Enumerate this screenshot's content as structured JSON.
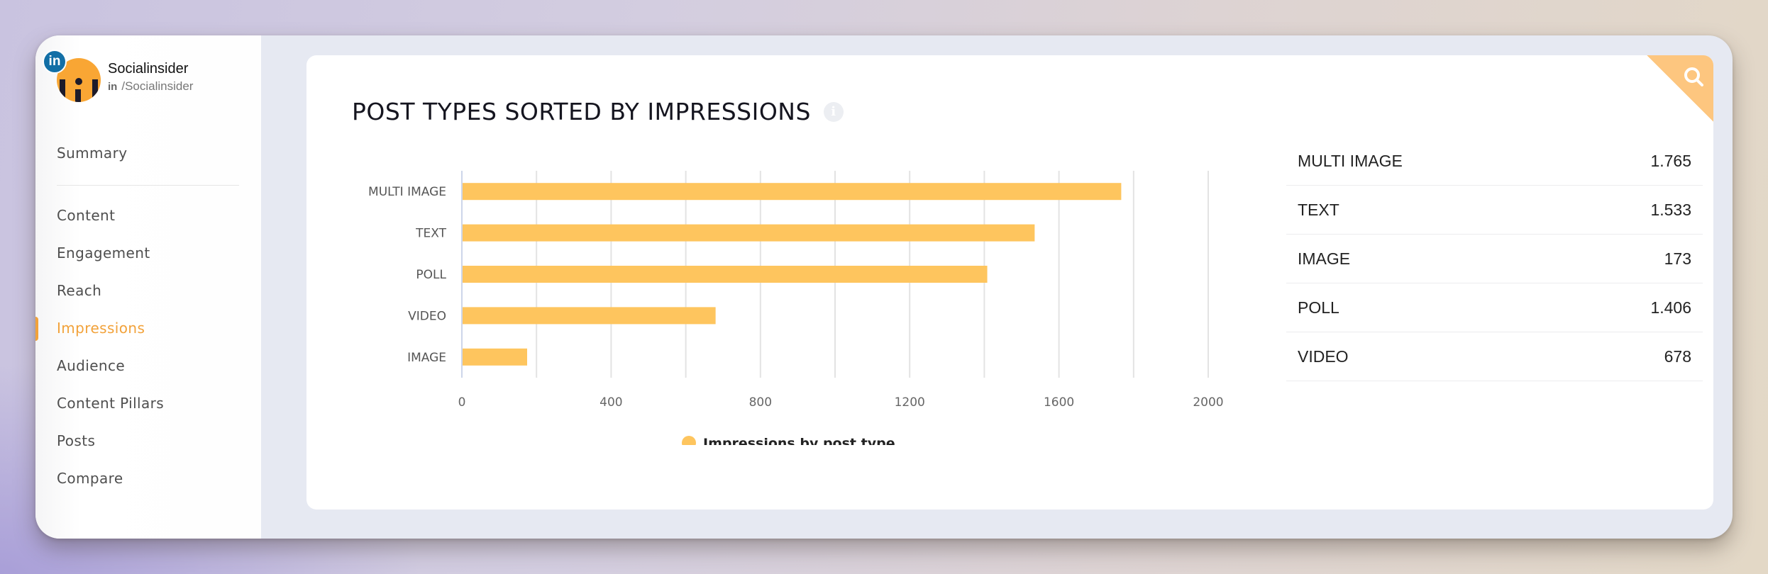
{
  "profile": {
    "name": "Socialinsider",
    "network_badge": "in",
    "handle_prefix": "in",
    "handle": "/Socialinsider"
  },
  "sidebar": {
    "items": [
      {
        "label": "Summary",
        "active": false
      },
      {
        "label": "Content",
        "active": false
      },
      {
        "label": "Engagement",
        "active": false
      },
      {
        "label": "Reach",
        "active": false
      },
      {
        "label": "Impressions",
        "active": true
      },
      {
        "label": "Audience",
        "active": false
      },
      {
        "label": "Content Pillars",
        "active": false
      },
      {
        "label": "Posts",
        "active": false
      },
      {
        "label": "Compare",
        "active": false
      }
    ]
  },
  "card": {
    "title": "POST TYPES SORTED BY IMPRESSIONS",
    "info_icon": "i",
    "corner_icon": "search-icon"
  },
  "colors": {
    "accent": "#f2a23a",
    "bar": "#fec55e",
    "linkedin": "#126fa6"
  },
  "chart_data": {
    "type": "bar",
    "orientation": "horizontal",
    "categories": [
      "MULTI IMAGE",
      "TEXT",
      "POLL",
      "VIDEO",
      "IMAGE"
    ],
    "series": [
      {
        "name": "Impressions by post type",
        "values": [
          1765,
          1533,
          1406,
          678,
          173
        ]
      }
    ],
    "xlim": [
      0,
      2000
    ],
    "xticks": [
      0,
      400,
      800,
      1200,
      1600,
      2000
    ],
    "xtick_labels": [
      "0",
      "400",
      "800",
      "1200",
      "1600",
      "2000"
    ],
    "grid_step": 200,
    "grid": true,
    "legend": "bottom-center",
    "title": "",
    "xlabel": "",
    "ylabel": ""
  },
  "table": {
    "rows": [
      {
        "label": "MULTI IMAGE",
        "value": "1.765"
      },
      {
        "label": "TEXT",
        "value": "1.533"
      },
      {
        "label": "IMAGE",
        "value": "173"
      },
      {
        "label": "POLL",
        "value": "1.406"
      },
      {
        "label": "VIDEO",
        "value": "678"
      }
    ]
  }
}
